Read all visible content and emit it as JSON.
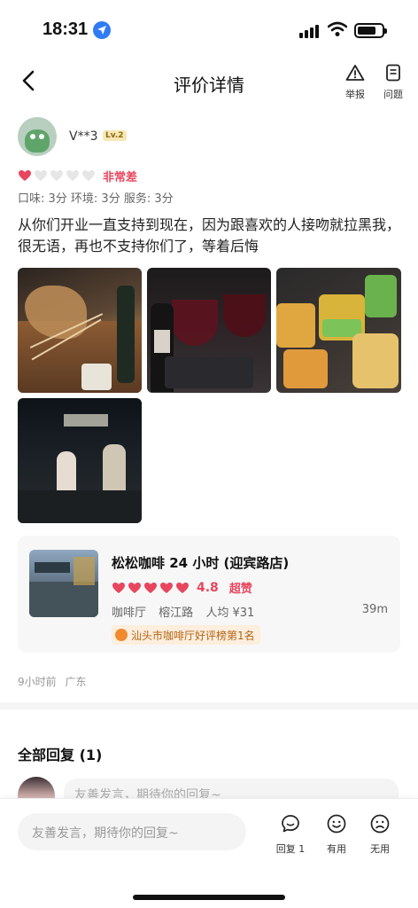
{
  "status_bar": {
    "time": "18:31",
    "icons": [
      "location-icon",
      "signal-icon",
      "wifi-icon",
      "battery-icon"
    ]
  },
  "nav": {
    "title": "评价详情",
    "report_label": "举报",
    "issue_label": "问题"
  },
  "review": {
    "username": "V**3",
    "level": "Lv.2",
    "rating_hearts_filled": 1,
    "rating_hearts_total": 5,
    "rating_text": "非常差",
    "sub_scores": "口味: 3分 环境: 3分 服务: 3分",
    "text": "从你们开业一直支持到现在，因为跟喜欢的人接吻就拉黑我，很无语，再也不支持你们了，等着后悔",
    "photo_count": 4,
    "time": "9小时前",
    "location": "广东"
  },
  "shop": {
    "name": "松松咖啡 24 小时 (迎宾路店)",
    "hearts": 5,
    "score": "4.8",
    "tag": "超赞",
    "category": "咖啡厅",
    "area": "榕江路",
    "avg_price": "人均 ¥31",
    "distance": "39m",
    "rank": "汕头市咖啡厅好评榜第1名"
  },
  "replies": {
    "title": "全部回复 (1)",
    "preview_placeholder": "友善发言，期待你的回复~"
  },
  "bottom_bar": {
    "input_placeholder": "友善发言，期待你的回复~",
    "reply_label": "回复 1",
    "useful_label": "有用",
    "useless_label": "无用"
  },
  "colors": {
    "accent_red": "#e8465c",
    "rank_text": "#b26414",
    "location_blue": "#2f7bf5"
  }
}
